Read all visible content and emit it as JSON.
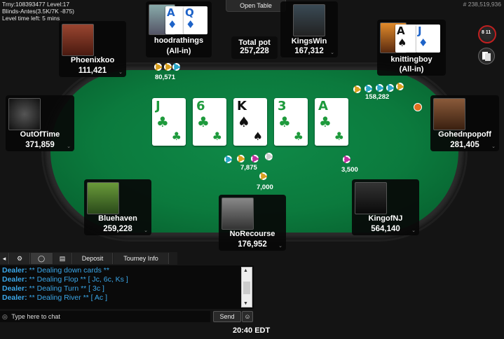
{
  "header": {
    "trny_line": "Trny:108393477 Level:17",
    "blinds_line": "Blinds-Antes(3.5K/7K -875)",
    "level_time_line": "Level time left: 5 mins",
    "hand_id": "# 238,519,936",
    "open_table": "Open Table"
  },
  "pot": {
    "label": "Total pot",
    "value": "257,228"
  },
  "players": {
    "hoodrathings": {
      "name": "hoodrathings",
      "status": "(All-in)",
      "bet": "80,571",
      "hole_cards": [
        {
          "rank": "A",
          "suit": "♦"
        },
        {
          "rank": "Q",
          "suit": "♦"
        }
      ]
    },
    "kingswin": {
      "name": "KingsWin",
      "stack": "167,312"
    },
    "knittingboy": {
      "name": "knittingboy",
      "status": "(All-in)",
      "bet": "158,282",
      "hole_cards": [
        {
          "rank": "A",
          "suit": "♠"
        },
        {
          "rank": "J",
          "suit": "♦"
        }
      ]
    },
    "phoenixkoo": {
      "name": "Phoenixkoo",
      "stack": "111,421"
    },
    "outoftime": {
      "name": "OutOfTime",
      "stack": "371,859"
    },
    "gohednpopoff": {
      "name": "Gohednpopoff",
      "stack": "281,405",
      "bet": "3,500"
    },
    "bluehaven": {
      "name": "Bluehaven",
      "stack": "259,228"
    },
    "norecourse": {
      "name": "NoRecourse",
      "stack": "176,952",
      "bet": "7,000"
    },
    "kingofnj": {
      "name": "KingofNJ",
      "stack": "564,140"
    }
  },
  "center_bet": "7,875",
  "board": [
    {
      "rank": "J",
      "suit": "♣",
      "color": "#1e9a3c"
    },
    {
      "rank": "6",
      "suit": "♣",
      "color": "#1e9a3c"
    },
    {
      "rank": "K",
      "suit": "♠",
      "color": "#111111"
    },
    {
      "rank": "3",
      "suit": "♣",
      "color": "#1e9a3c"
    },
    {
      "rank": "A",
      "suit": "♣",
      "color": "#1e9a3c"
    }
  ],
  "chat": {
    "tabs": {
      "deposit": "Deposit",
      "tourney_info": "Tourney Info"
    },
    "lines": [
      {
        "speaker": "Dealer:",
        "text": "** Dealing down cards **"
      },
      {
        "speaker": "Dealer:",
        "text": "** Dealing Flop ** [ Jc, 6c, Ks ]"
      },
      {
        "speaker": "Dealer:",
        "text": "** Dealing Turn ** [ 3c ]"
      },
      {
        "speaker": "Dealer:",
        "text": "** Dealing River ** [ Ac ]"
      }
    ],
    "input_placeholder": "Type here to chat",
    "send_label": "Send",
    "emoji_label": ":-)"
  },
  "clock": "20:40 EDT",
  "icons": {
    "settings": "gear-icon",
    "chat_bubble": "chat-bubble-icon",
    "notes": "notes-icon",
    "info": "info-icon"
  },
  "colors": {
    "felt": "#0b7a3d",
    "dealer_text": "#3aa6e8",
    "club_green": "#1e9a3c",
    "diamond_blue": "#1e63c8"
  },
  "side_badge": "8 11"
}
